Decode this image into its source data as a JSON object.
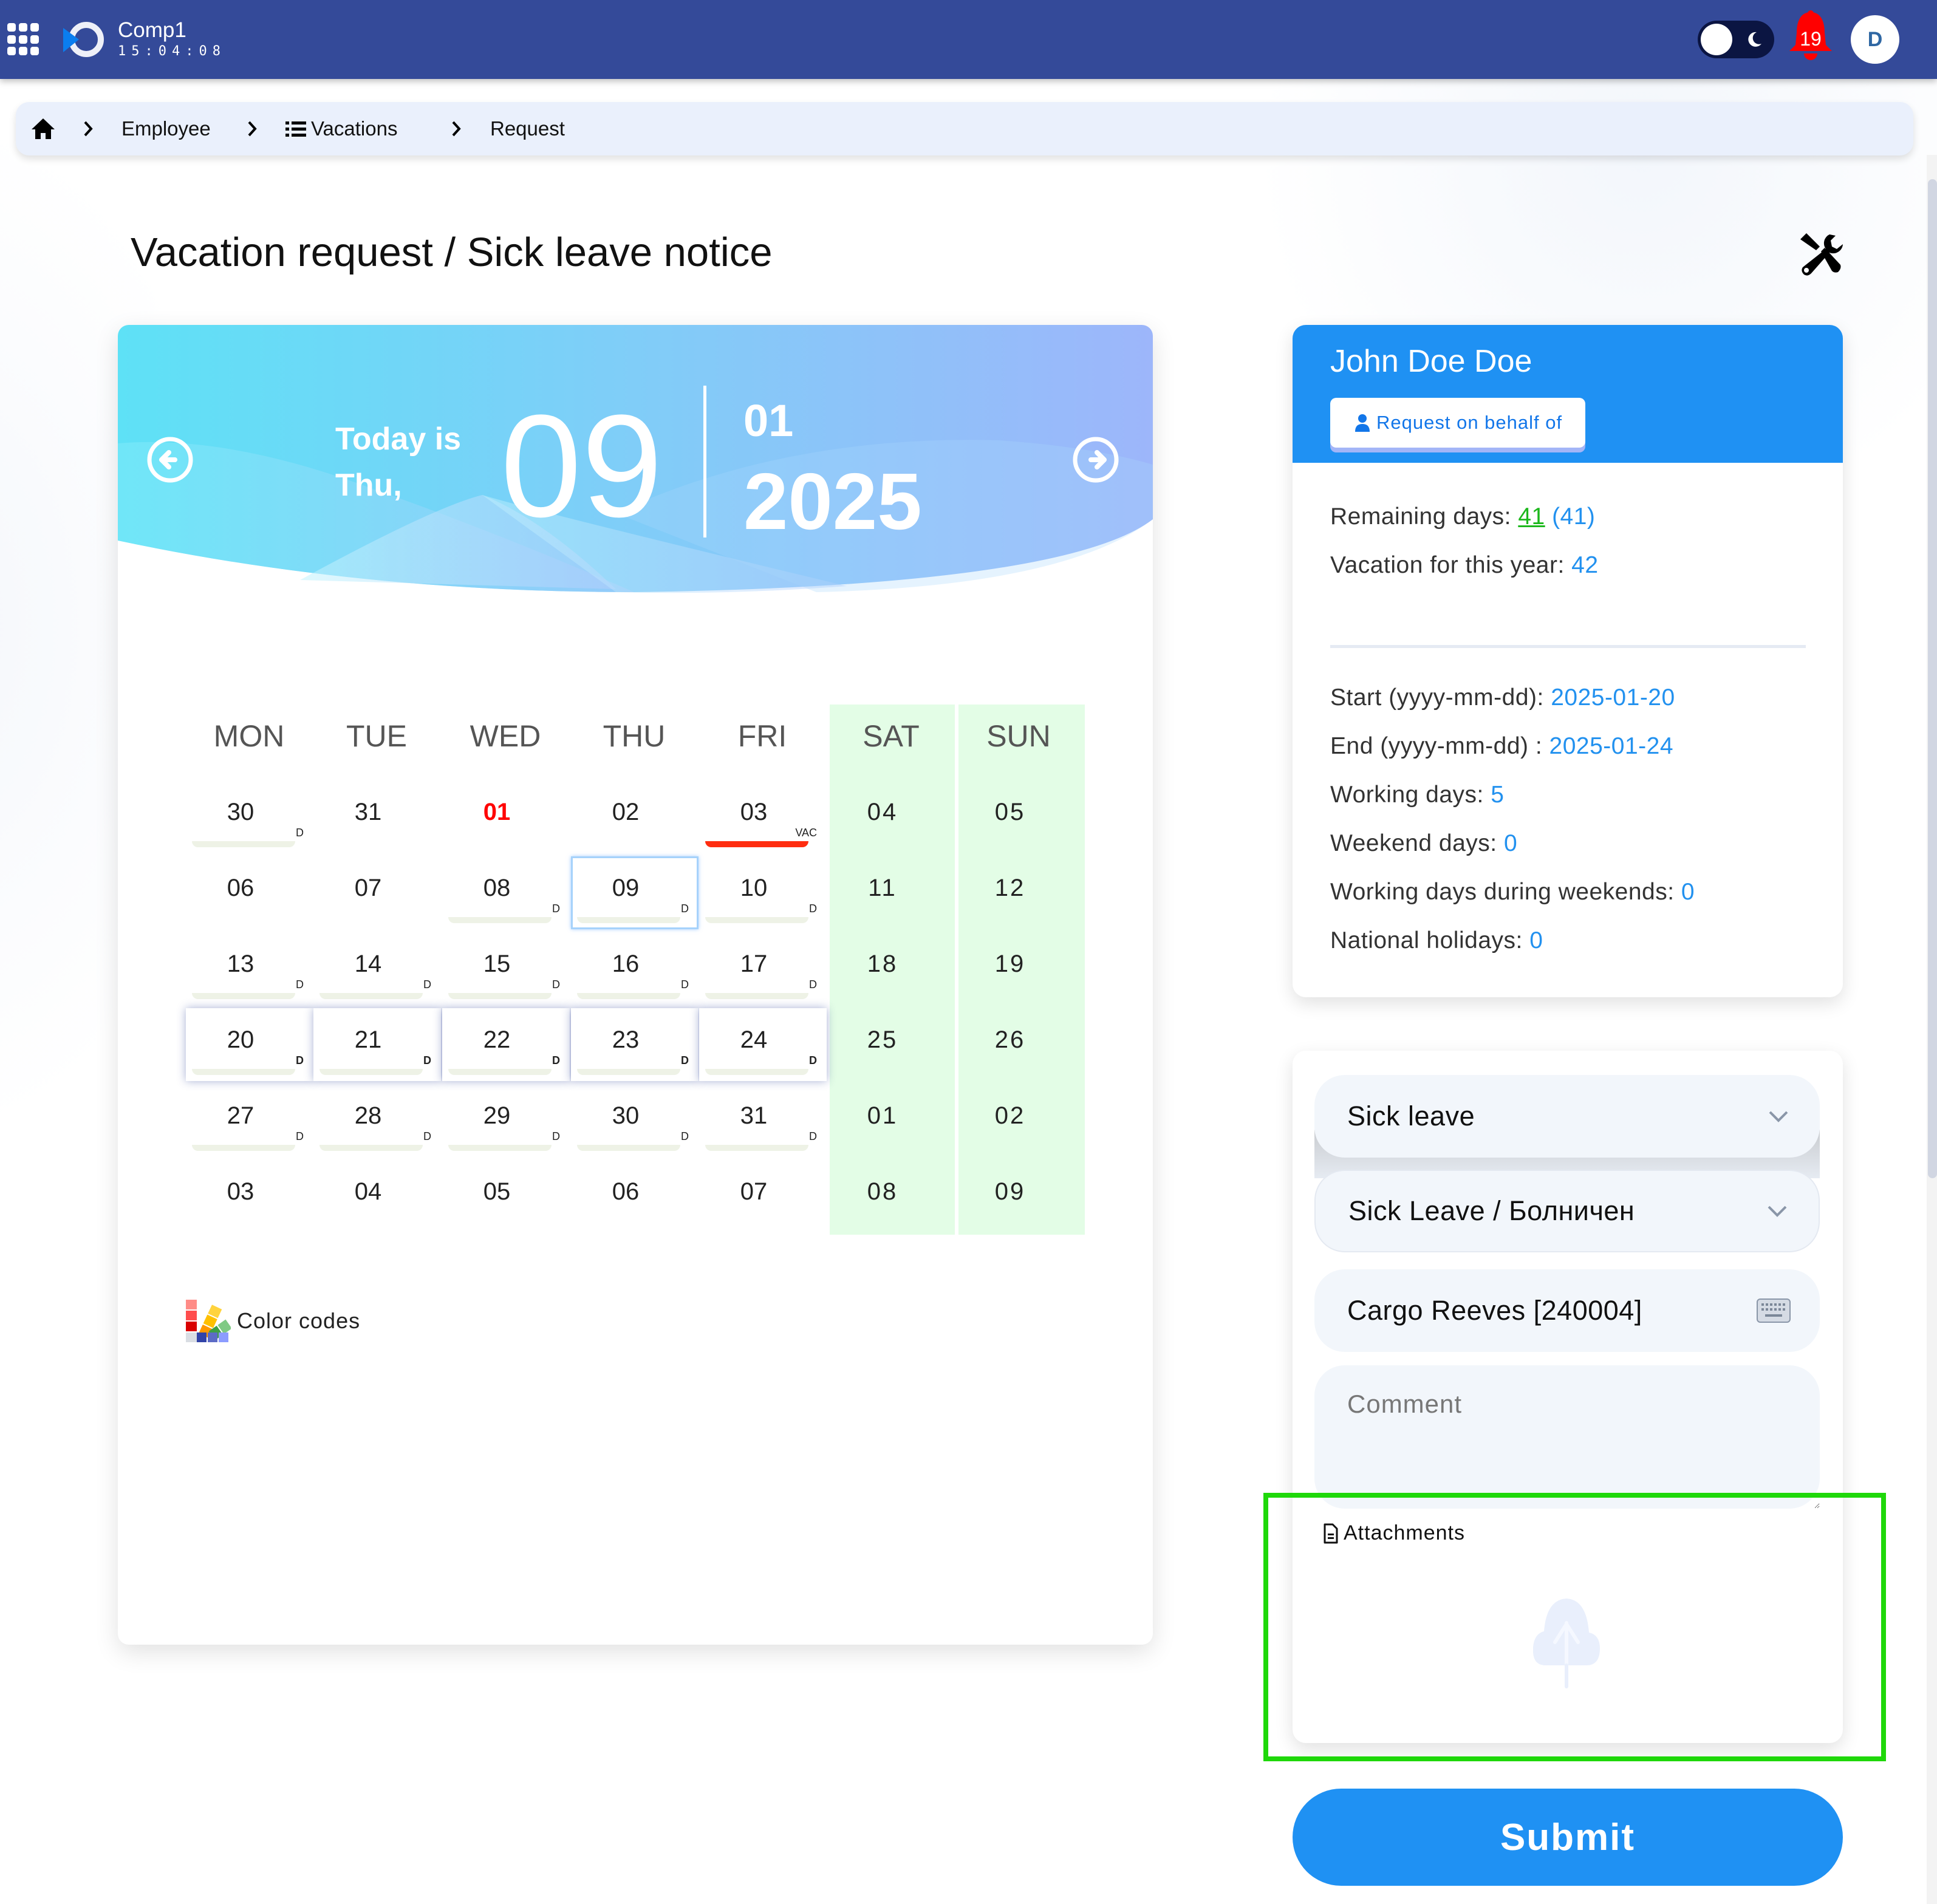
{
  "topbar": {
    "company": "Comp1",
    "clock": "15:04:08",
    "notifications_count": "19",
    "avatar_initial": "D",
    "theme": "light"
  },
  "breadcrumb": {
    "items": [
      {
        "label": "",
        "icon": "home-icon"
      },
      {
        "label": "Employee"
      },
      {
        "label": "Vacations",
        "icon": "list-icon"
      },
      {
        "label": "Request"
      }
    ]
  },
  "page": {
    "title": "Vacation request / Sick leave notice"
  },
  "calendar": {
    "today_label_line1": "Today is",
    "today_label_line2": "Thu,",
    "today_day": "09",
    "month": "01",
    "year": "2025",
    "weekdays": [
      "MON",
      "TUE",
      "WED",
      "THU",
      "FRI",
      "SAT",
      "SUN"
    ],
    "weeks": [
      [
        {
          "d": "30",
          "tag": "D",
          "bar": "grey"
        },
        {
          "d": "31"
        },
        {
          "d": "01",
          "holiday": true
        },
        {
          "d": "02"
        },
        {
          "d": "03",
          "tag": "VAC",
          "bar": "red"
        },
        {
          "d": "04",
          "weekend": true
        },
        {
          "d": "05",
          "weekend": true
        }
      ],
      [
        {
          "d": "06"
        },
        {
          "d": "07"
        },
        {
          "d": "08",
          "tag": "D",
          "bar": "grey"
        },
        {
          "d": "09",
          "tag": "D",
          "bar": "grey",
          "today": true
        },
        {
          "d": "10",
          "tag": "D",
          "bar": "grey"
        },
        {
          "d": "11",
          "weekend": true
        },
        {
          "d": "12",
          "weekend": true
        }
      ],
      [
        {
          "d": "13",
          "tag": "D",
          "bar": "grey"
        },
        {
          "d": "14",
          "tag": "D",
          "bar": "grey"
        },
        {
          "d": "15",
          "tag": "D",
          "bar": "grey"
        },
        {
          "d": "16",
          "tag": "D",
          "bar": "grey"
        },
        {
          "d": "17",
          "tag": "D",
          "bar": "grey"
        },
        {
          "d": "18",
          "weekend": true
        },
        {
          "d": "19",
          "weekend": true
        }
      ],
      [
        {
          "d": "20",
          "tag": "D",
          "bar": "grey",
          "selected": true
        },
        {
          "d": "21",
          "tag": "D",
          "bar": "grey",
          "selected": true
        },
        {
          "d": "22",
          "tag": "D",
          "bar": "grey",
          "selected": true
        },
        {
          "d": "23",
          "tag": "D",
          "bar": "grey",
          "selected": true
        },
        {
          "d": "24",
          "tag": "D",
          "bar": "grey",
          "selected": true
        },
        {
          "d": "25",
          "weekend": true
        },
        {
          "d": "26",
          "weekend": true
        }
      ],
      [
        {
          "d": "27",
          "tag": "D",
          "bar": "grey"
        },
        {
          "d": "28",
          "tag": "D",
          "bar": "grey"
        },
        {
          "d": "29",
          "tag": "D",
          "bar": "grey"
        },
        {
          "d": "30",
          "tag": "D",
          "bar": "grey"
        },
        {
          "d": "31",
          "tag": "D",
          "bar": "grey"
        },
        {
          "d": "01",
          "weekend": true
        },
        {
          "d": "02",
          "weekend": true
        }
      ],
      [
        {
          "d": "03"
        },
        {
          "d": "04"
        },
        {
          "d": "05"
        },
        {
          "d": "06"
        },
        {
          "d": "07"
        },
        {
          "d": "08",
          "weekend": true
        },
        {
          "d": "09",
          "weekend": true
        }
      ]
    ],
    "color_codes_label": "Color codes"
  },
  "employee": {
    "name": "John Doe Doe",
    "behalf_button": "Request on behalf of",
    "remaining_label": "Remaining days:",
    "remaining_value": "41",
    "remaining_total": "(41)",
    "vacation_year_label": "Vacation for this year:",
    "vacation_year_value": "42",
    "start_label": "Start (yyyy-mm-dd):",
    "start_value": "2025-01-20",
    "end_label": "End (yyyy-mm-dd) :",
    "end_value": "2025-01-24",
    "working_days_label": "Working days:",
    "working_days_value": "5",
    "weekend_days_label": "Weekend days:",
    "weekend_days_value": "0",
    "working_weekends_label": "Working days during weekends:",
    "working_weekends_value": "0",
    "national_holidays_label": "National holidays:",
    "national_holidays_value": "0"
  },
  "form": {
    "leave_type": "Sick leave",
    "leave_subtype": "Sick Leave / Болничен",
    "substitute": "Cargo Reeves [240004]",
    "comment_placeholder": "Comment",
    "comment_value": "",
    "attachments_label": "Attachments",
    "submit_label": "Submit"
  },
  "colors": {
    "topbar": "#344a99",
    "primary": "#1f91f3",
    "weekend": "#e3fde6",
    "holiday": "#ff0000",
    "vacation_bar": "#ff2d10",
    "highlight": "#1fd80a"
  }
}
